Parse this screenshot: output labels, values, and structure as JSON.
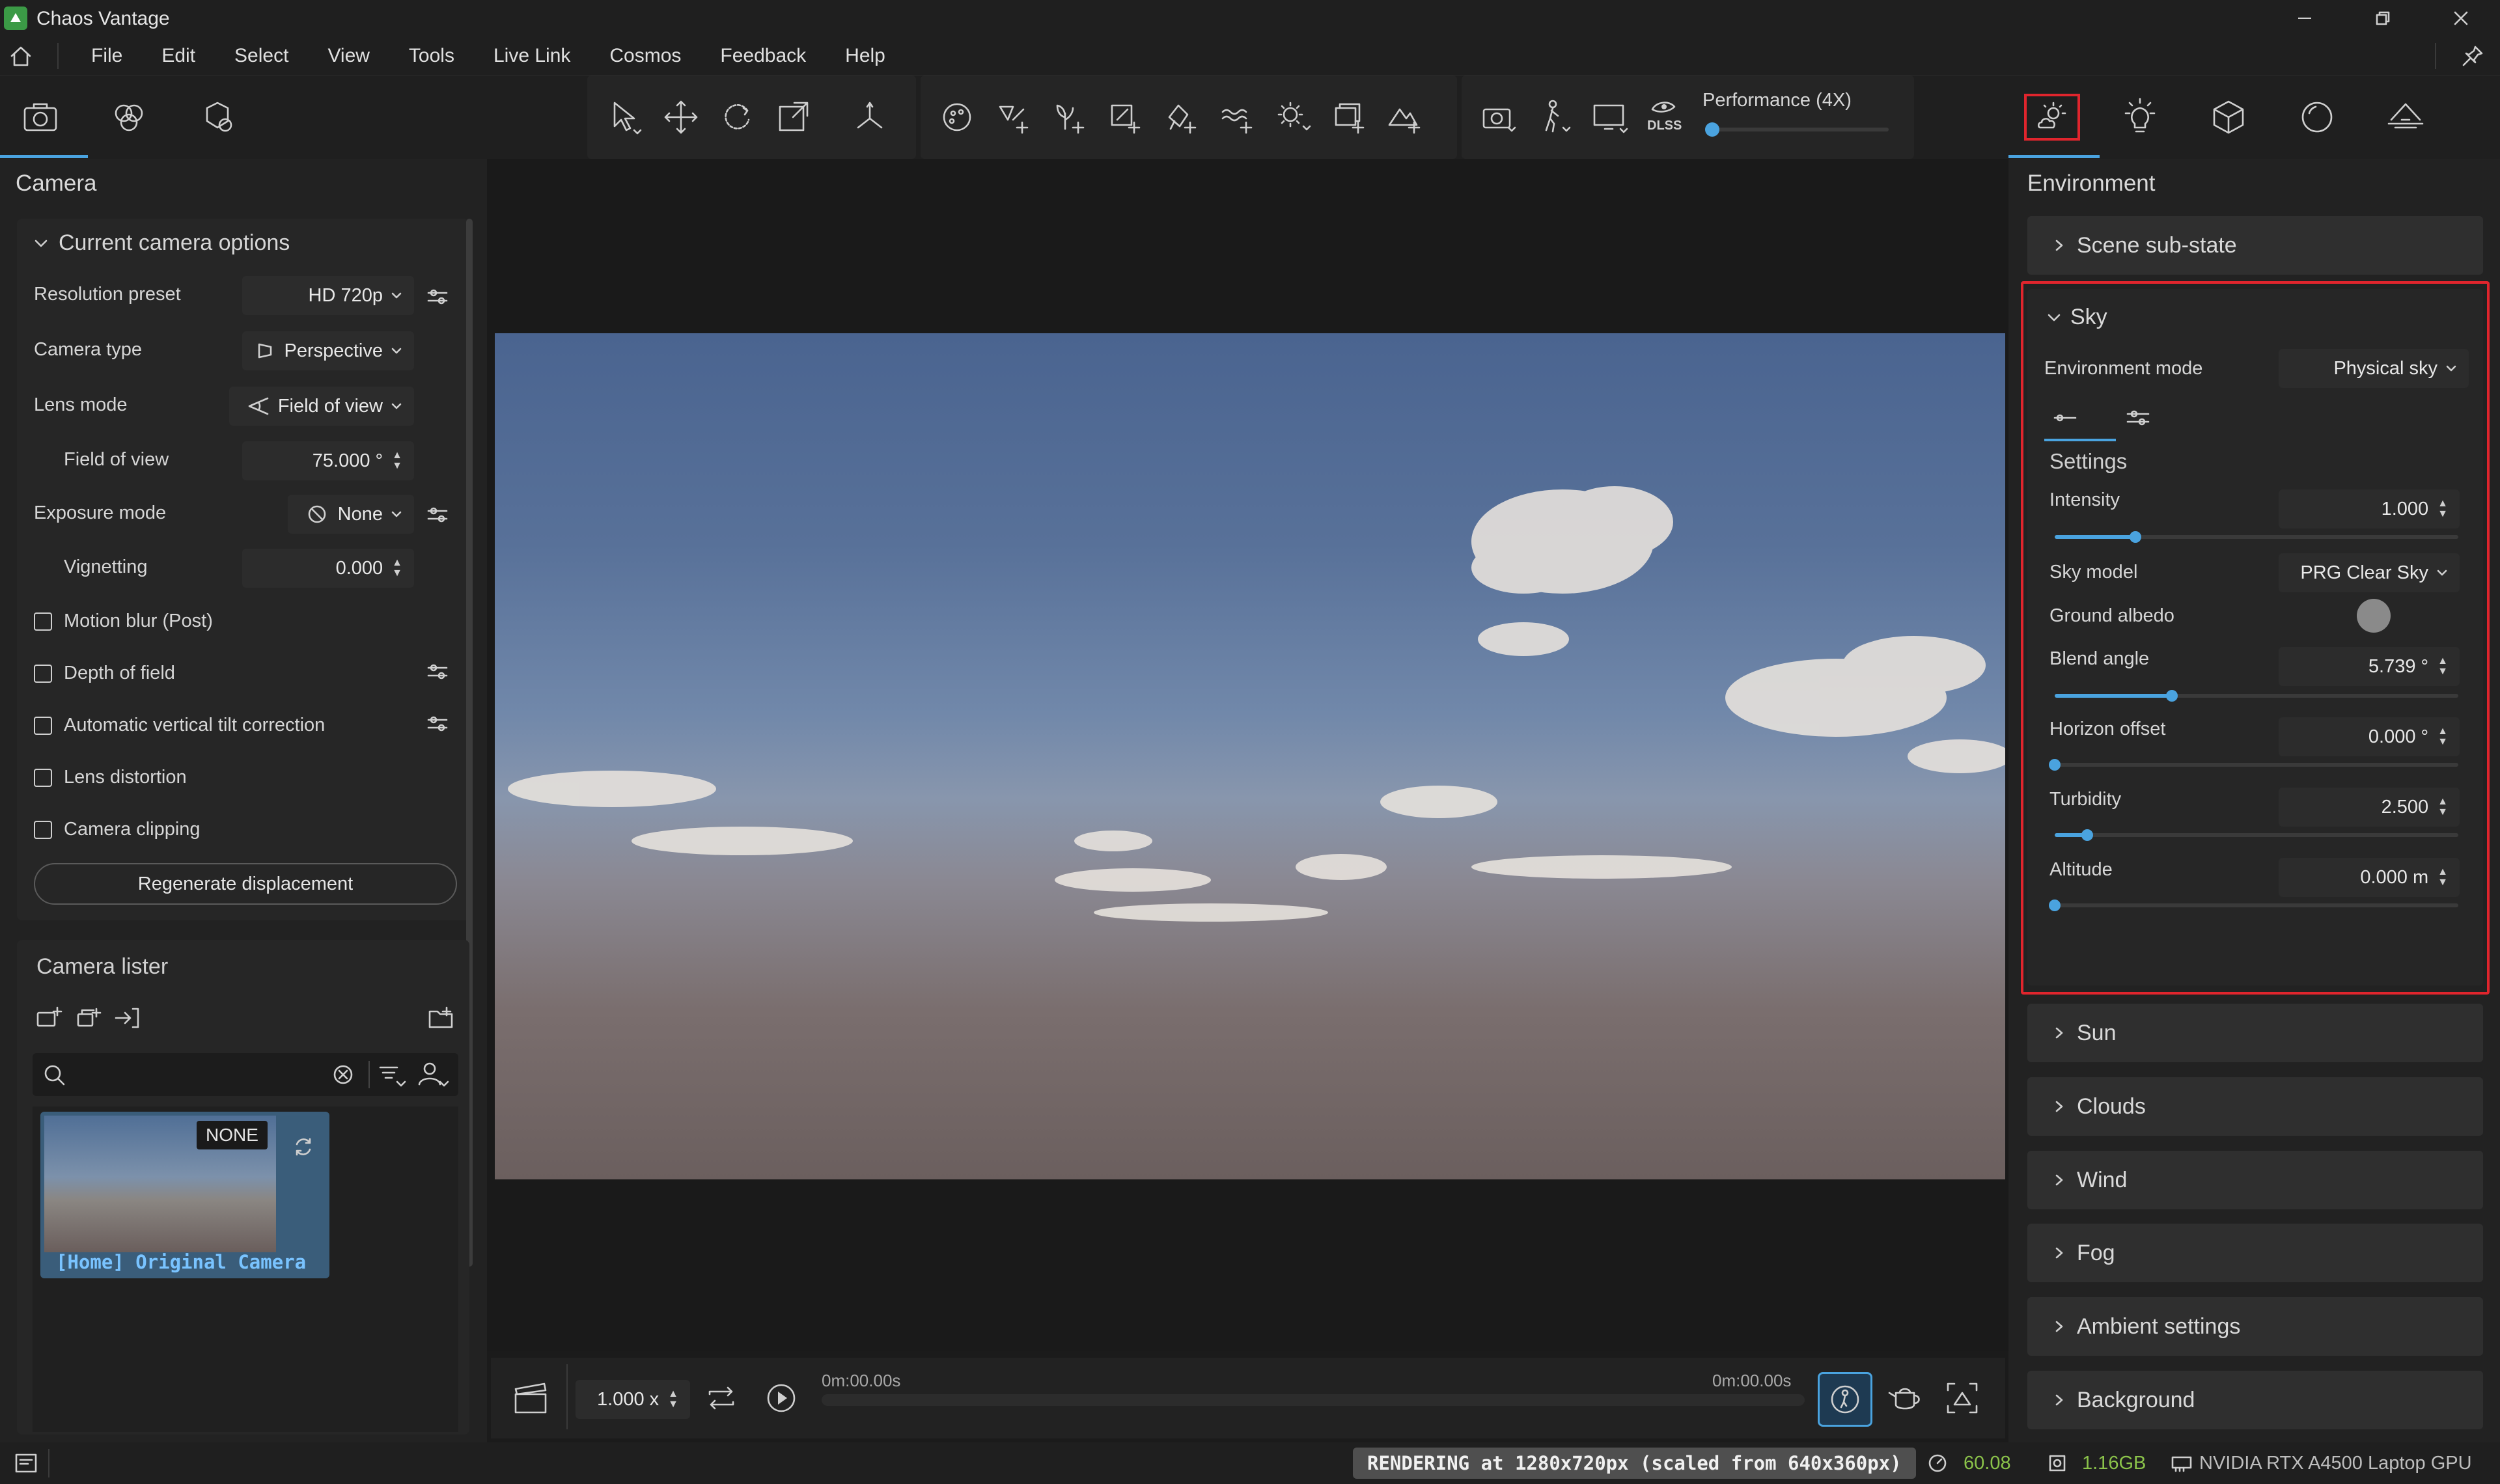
{
  "app": {
    "title": "Chaos Vantage"
  },
  "menu": [
    "File",
    "Edit",
    "Select",
    "View",
    "Tools",
    "Live Link",
    "Cosmos",
    "Feedback",
    "Help"
  ],
  "toolbar": {
    "performance_label": "Performance (4X)",
    "performance_level": 0.0,
    "dlss_label": "DLSS"
  },
  "camera_panel": {
    "title": "Camera",
    "section_title": "Current camera options",
    "rows": {
      "resolution_label": "Resolution preset",
      "resolution_value": "HD 720p",
      "camera_type_label": "Camera type",
      "camera_type_value": "Perspective",
      "lens_mode_label": "Lens mode",
      "lens_mode_value": "Field of view",
      "fov_label": "Field of view",
      "fov_value": "75.000 °",
      "exposure_label": "Exposure mode",
      "exposure_value": "None",
      "vignetting_label": "Vignetting",
      "vignetting_value": "0.000"
    },
    "checkboxes": {
      "motion_blur": "Motion blur (Post)",
      "depth_of_field": "Depth of field",
      "tilt": "Automatic vertical tilt correction",
      "lens_distortion": "Lens distortion",
      "clipping": "Camera clipping"
    },
    "regenerate_button": "Regenerate displacement"
  },
  "camera_lister": {
    "title": "Camera lister",
    "search_placeholder": "",
    "thumbnail_badge": "NONE",
    "thumbnail_caption": "[Home] Original Camera"
  },
  "timeline": {
    "speed_value": "1.000 x",
    "time_start": "0m:00.00s",
    "time_end": "0m:00.00s"
  },
  "environment": {
    "title": "Environment",
    "scene_substate": "Scene sub-state",
    "sky_title": "Sky",
    "env_mode_label": "Environment mode",
    "env_mode_value": "Physical sky",
    "settings_label": "Settings",
    "intensity_label": "Intensity",
    "intensity_value": "1.000",
    "intensity_level": 0.2,
    "sky_model_label": "Sky model",
    "sky_model_value": "PRG Clear Sky",
    "ground_albedo_label": "Ground albedo",
    "blend_label": "Blend angle",
    "blend_value": "5.739 °",
    "blend_level": 0.29,
    "horizon_label": "Horizon offset",
    "horizon_value": "0.000 °",
    "horizon_level": 0.0,
    "turbidity_label": "Turbidity",
    "turbidity_value": "2.500",
    "turbidity_level": 0.08,
    "altitude_label": "Altitude",
    "altitude_value": "0.000 m",
    "altitude_level": 0.0,
    "sections": [
      "Sun",
      "Clouds",
      "Wind",
      "Fog",
      "Ambient settings",
      "Background"
    ]
  },
  "status": {
    "rendering": "RENDERING at 1280x720px (scaled from 640x360px)",
    "fps": "60.08",
    "memory": "1.16GB",
    "gpu": "NVIDIA RTX A4500 Laptop GPU"
  },
  "colors": {
    "accent": "#4aa3df",
    "highlight": "#e0252d",
    "fps": "#8bc34a"
  }
}
